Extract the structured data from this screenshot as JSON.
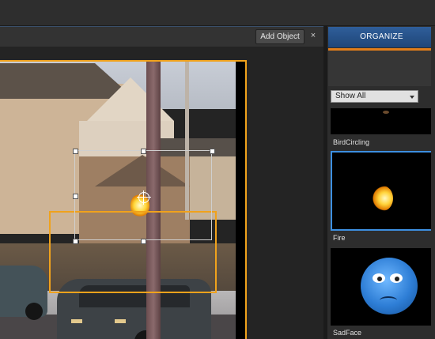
{
  "panel_header": {
    "add_object_label": "Add Object",
    "close_label": "×"
  },
  "right_panel": {
    "tab_label": "ORGANIZE",
    "filter": {
      "selected": "Show All"
    },
    "thumbnails": [
      {
        "label": "BirdCircling",
        "selected": false
      },
      {
        "label": "Fire",
        "selected": true
      },
      {
        "label": "SadFace",
        "selected": false
      }
    ]
  },
  "colors": {
    "accent_orange": "#f0a21c",
    "selection_blue": "#3d8fe0",
    "tab_blue": "#2f5e9a"
  },
  "icons": [
    "close-icon",
    "crosshair-icon",
    "chevron-down-icon"
  ]
}
